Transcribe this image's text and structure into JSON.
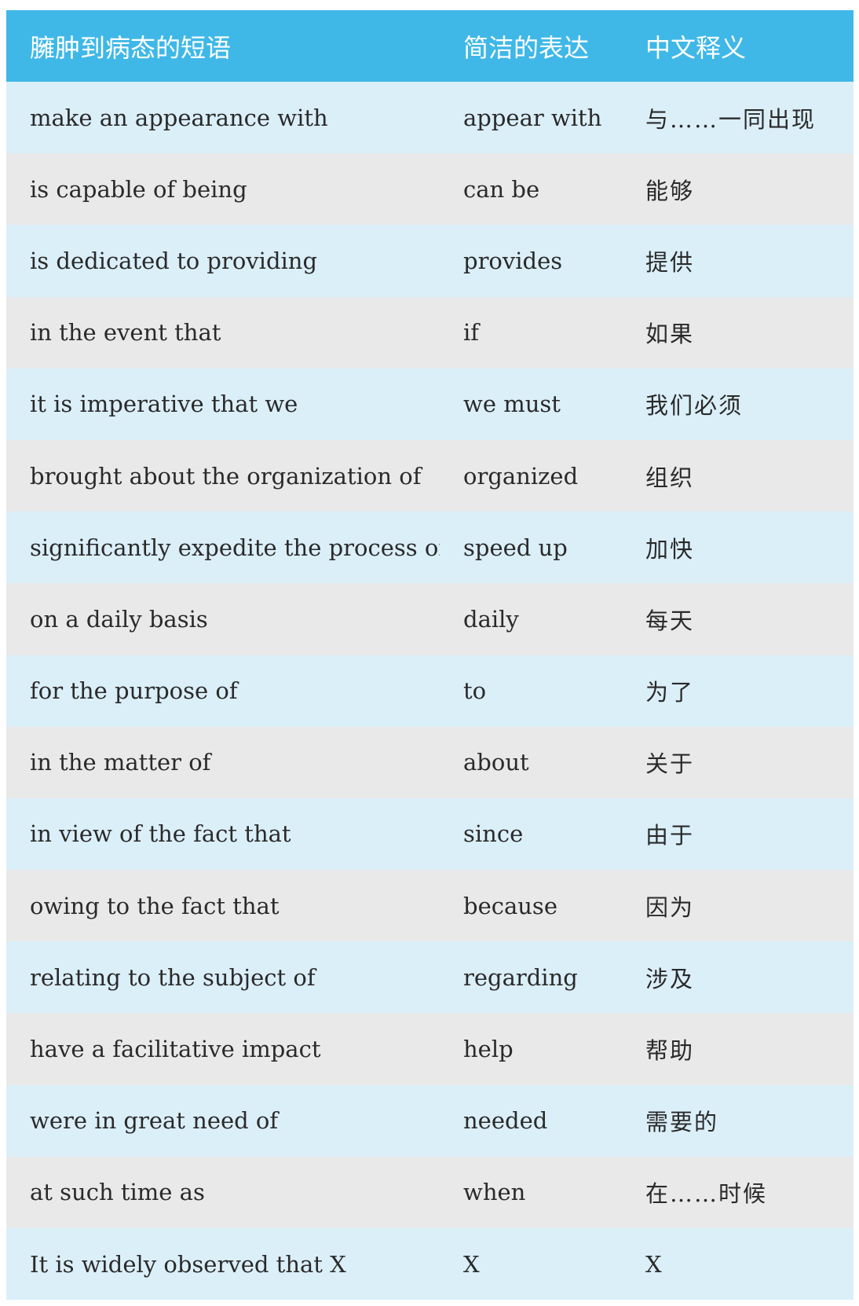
{
  "header": {
    "col1": "臃肿到病态的短语",
    "col2": "简洁的表达",
    "col3": "中文释义"
  },
  "rows": [
    {
      "phrase": "make an appearance with",
      "concise": "appear with",
      "meaning": "与……一同出现"
    },
    {
      "phrase": "is capable of being",
      "concise": "can be",
      "meaning": "能够"
    },
    {
      "phrase": "is dedicated to providing",
      "concise": "provides",
      "meaning": "提供"
    },
    {
      "phrase": "in the event that",
      "concise": "if",
      "meaning": "如果"
    },
    {
      "phrase": "it is imperative that we",
      "concise": "we must",
      "meaning": "我们必须"
    },
    {
      "phrase": "brought about the organization of",
      "concise": "organized",
      "meaning": "组织"
    },
    {
      "phrase": "significantly expedite the process of",
      "concise": "speed up",
      "meaning": "加快"
    },
    {
      "phrase": "on a daily basis",
      "concise": "daily",
      "meaning": "每天"
    },
    {
      "phrase": "for the purpose of",
      "concise": "to",
      "meaning": "为了"
    },
    {
      "phrase": "in the matter of",
      "concise": "about",
      "meaning": "关于"
    },
    {
      "phrase": "in view of the fact that",
      "concise": "since",
      "meaning": "由于"
    },
    {
      "phrase": "owing to the fact that",
      "concise": "because",
      "meaning": "因为"
    },
    {
      "phrase": "relating to the subject of",
      "concise": "regarding",
      "meaning": "涉及"
    },
    {
      "phrase": "have a facilitative impact",
      "concise": "help",
      "meaning": "帮助"
    },
    {
      "phrase": "were in great need of",
      "concise": "needed",
      "meaning": "需要的"
    },
    {
      "phrase": "at such time as",
      "concise": "when",
      "meaning": "在……时候"
    },
    {
      "phrase": "It is widely observed that X",
      "concise": "X",
      "meaning": "X"
    }
  ],
  "colors": {
    "header_bg": "#3fb8e8",
    "row_blue": "#dbeff9",
    "row_gray": "#e9e9ea"
  }
}
